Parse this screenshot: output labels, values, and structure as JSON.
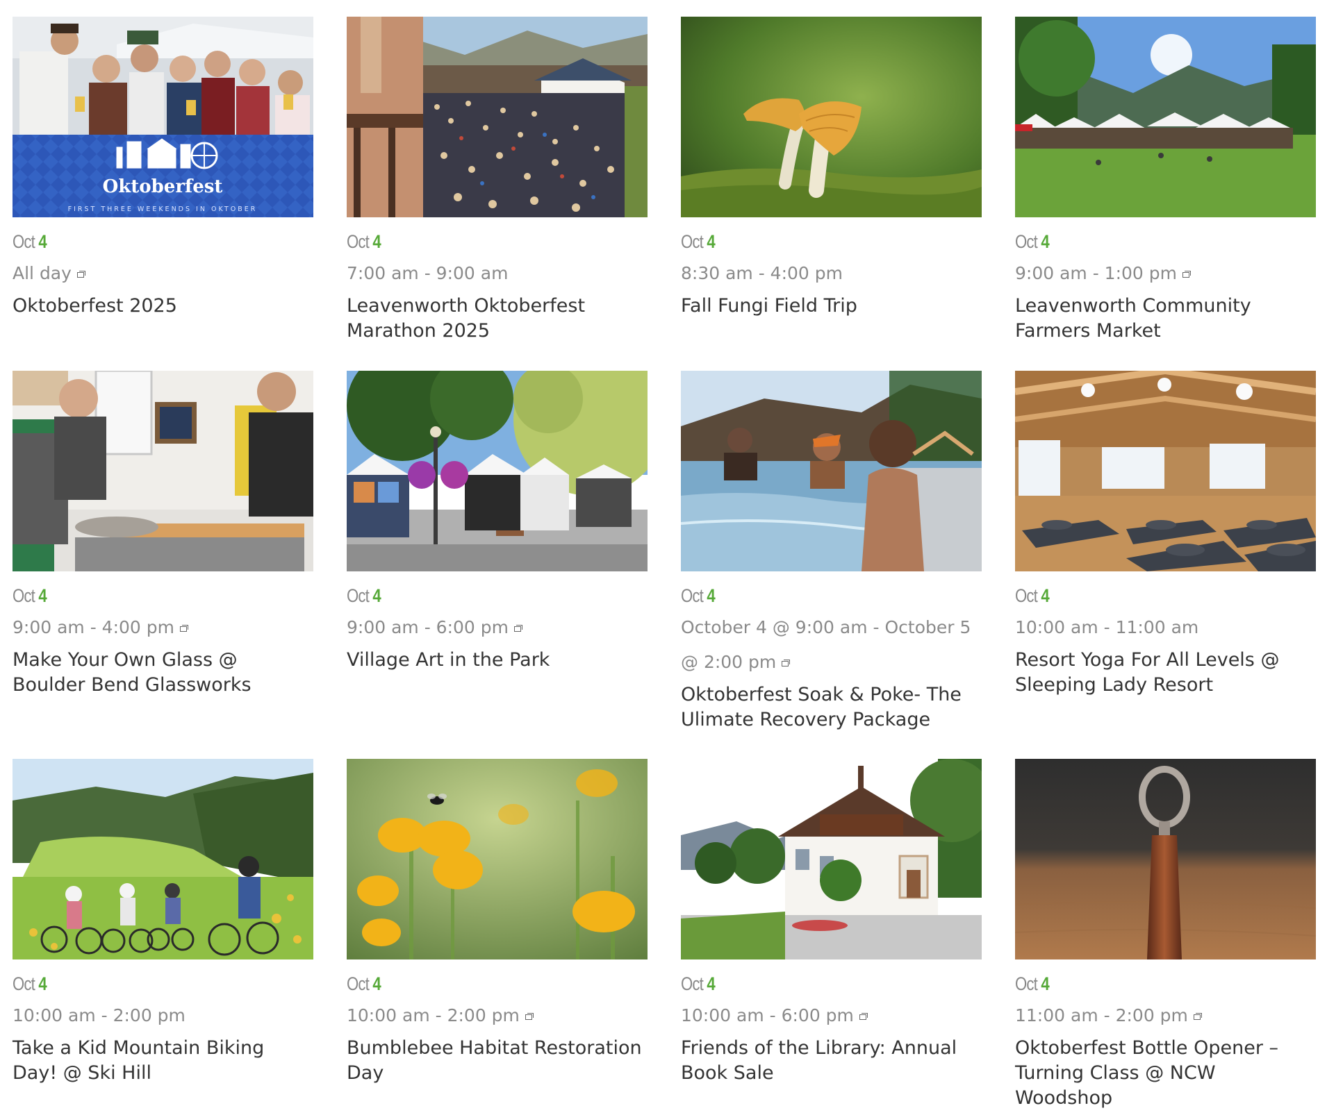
{
  "events": [
    {
      "month": "Oct",
      "day": "4",
      "time": "All day",
      "recurring": true,
      "title": "Oktoberfest 2025",
      "image": "oktoberfest-banner"
    },
    {
      "month": "Oct",
      "day": "4",
      "time": "7:00 am - 9:00 am",
      "recurring": false,
      "title": "Leavenworth Oktoberfest Marathon 2025",
      "image": "marathon-crowd"
    },
    {
      "month": "Oct",
      "day": "4",
      "time": "8:30 am - 4:00 pm",
      "recurring": false,
      "title": "Fall Fungi Field Trip",
      "image": "mushroom"
    },
    {
      "month": "Oct",
      "day": "4",
      "time": "9:00 am - 1:00 pm",
      "recurring": true,
      "title": "Leavenworth Community Farmers Market",
      "image": "farmers-market-tents"
    },
    {
      "month": "Oct",
      "day": "4",
      "time": "9:00 am - 4:00 pm",
      "recurring": true,
      "title": "Make Your Own Glass @ Boulder Bend Glassworks",
      "image": "glass-workshop"
    },
    {
      "month": "Oct",
      "day": "4",
      "time": "9:00 am - 6:00 pm",
      "recurring": true,
      "title": "Village Art in the Park",
      "image": "art-park-tents"
    },
    {
      "month": "Oct",
      "day": "4",
      "time": "October 4 @ 9:00 am - October 5 @ 2:00 pm",
      "recurring": true,
      "title": "Oktoberfest Soak & Poke- The Ulimate Recovery Package",
      "image": "hot-tub"
    },
    {
      "month": "Oct",
      "day": "4",
      "time": "10:00 am - 11:00 am",
      "recurring": false,
      "title": "Resort Yoga For All Levels @ Sleeping Lady Resort",
      "image": "yoga-hall"
    },
    {
      "month": "Oct",
      "day": "4",
      "time": "10:00 am - 2:00 pm",
      "recurring": false,
      "title": "Take a Kid Mountain Biking Day! @ Ski Hill",
      "image": "kids-biking"
    },
    {
      "month": "Oct",
      "day": "4",
      "time": "10:00 am - 2:00 pm",
      "recurring": true,
      "title": "Bumblebee Habitat Restoration Day",
      "image": "yellow-flowers"
    },
    {
      "month": "Oct",
      "day": "4",
      "time": "10:00 am - 6:00 pm",
      "recurring": true,
      "title": "Friends of the Library: Annual Book Sale",
      "image": "library-building"
    },
    {
      "month": "Oct",
      "day": "4",
      "time": "11:00 am - 2:00 pm",
      "recurring": true,
      "title": "Oktoberfest Bottle Opener – Turning Class @ NCW Woodshop",
      "image": "bottle-opener"
    }
  ],
  "banner": {
    "logo_text": "Oktoberfest",
    "tagline": "FIRST THREE WEEKENDS IN OKTOBER"
  },
  "colors": {
    "day_accent": "#56a938",
    "month": "#888888",
    "time": "#8a8a8a",
    "title": "#333333",
    "banner_blue": "#2d57b8"
  }
}
